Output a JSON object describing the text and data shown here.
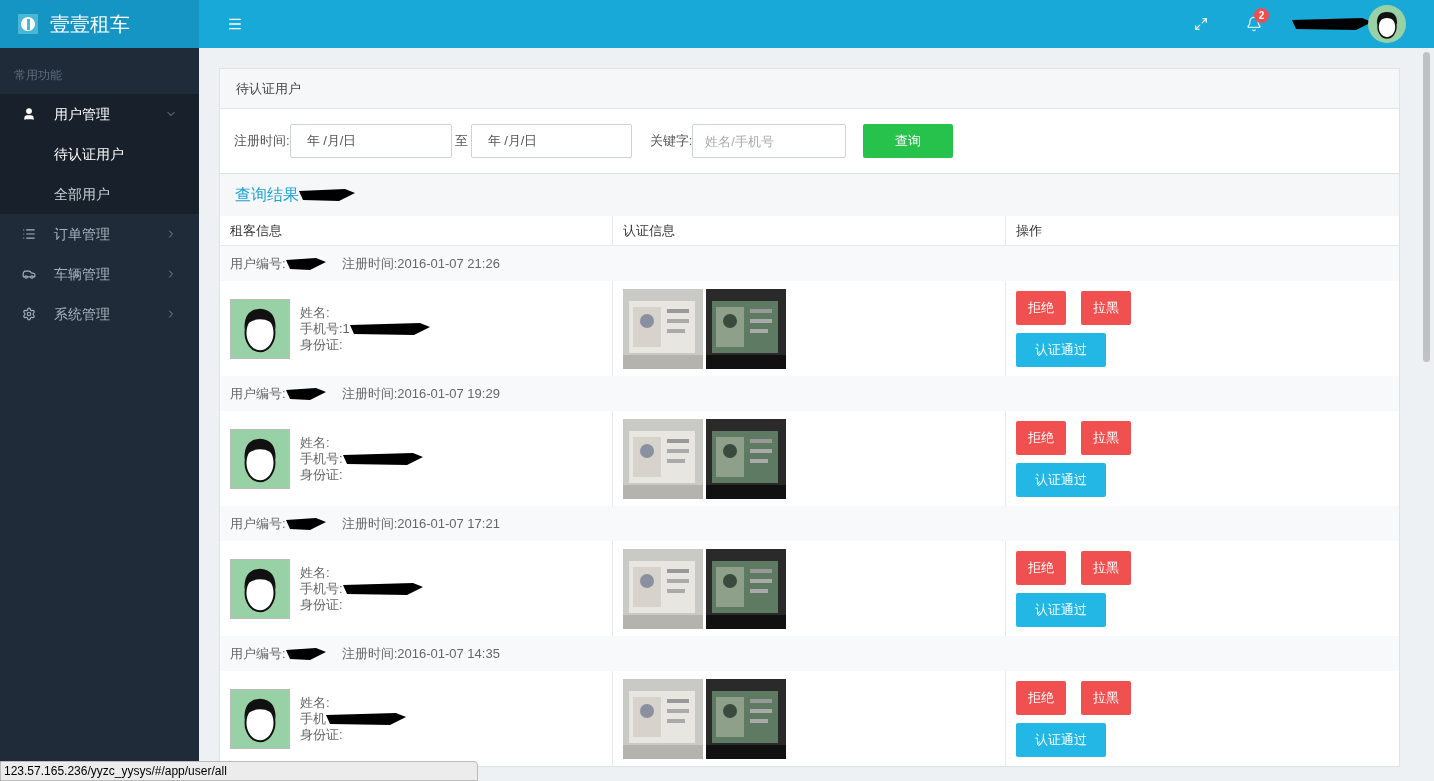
{
  "brand": {
    "name": "壹壹租车"
  },
  "header": {
    "notification_count": "2"
  },
  "sidebar": {
    "section": "常用功能",
    "items": [
      {
        "label": "用户管理",
        "kind": "user",
        "expanded": true,
        "selected": false,
        "children": [
          {
            "label": "待认证用户",
            "selected": true
          },
          {
            "label": "全部用户",
            "selected": false
          }
        ]
      },
      {
        "label": "订单管理",
        "kind": "list",
        "expanded": false,
        "selected": false
      },
      {
        "label": "车辆管理",
        "kind": "car",
        "expanded": false,
        "selected": false
      },
      {
        "label": "系统管理",
        "kind": "gear",
        "expanded": false,
        "selected": false
      }
    ]
  },
  "panel": {
    "title": "待认证用户",
    "filters": {
      "date_label": "注册时间:",
      "date_from": {
        "value": "年 /月/日"
      },
      "date_sep": "至",
      "date_to": {
        "value": "年 /月/日"
      },
      "keyword_label": "关键字:",
      "keyword": {
        "placeholder": "姓名/手机号"
      },
      "search_button": "查询"
    },
    "results_title": "查询结果",
    "columns": [
      "租客信息",
      "认证信息",
      "操作"
    ],
    "users": [
      {
        "id_label": "用户编号:",
        "registered": "注册时间:2016-01-07 21:26",
        "name_label": "姓名:",
        "phone_label": "手机号:1",
        "id_card_label": "身份证:",
        "photos": [
          {
            "kind": "picture"
          },
          {
            "kind": "picture"
          }
        ],
        "actions": [
          "拒绝",
          "拉黑",
          "认证通过"
        ]
      },
      {
        "id_label": "用户编号:",
        "registered": "注册时间:2016-01-07 19:29",
        "name_label": "姓名:",
        "phone_label": "手机号:",
        "id_card_label": "身份证:",
        "photos": [
          {
            "kind": "picture"
          },
          {
            "kind": "picture"
          }
        ],
        "actions": [
          "拒绝",
          "拉黑",
          "认证通过"
        ]
      },
      {
        "id_label": "用户编号:",
        "registered": "注册时间:2016-01-07 17:21",
        "name_label": "姓名:",
        "phone_label": "手机号:",
        "id_card_label": "身份证:",
        "photos": [
          {
            "kind": "picture"
          },
          {
            "kind": "picture"
          }
        ],
        "actions": [
          "拒绝",
          "拉黑",
          "认证通过"
        ]
      },
      {
        "id_label": "用户编号:",
        "registered": "注册时间:2016-01-07 14:35",
        "name_label": "姓名:",
        "phone_label": "手机",
        "id_card_label": "身份证:",
        "photos": [
          {
            "kind": "picture"
          },
          {
            "kind": "picture"
          }
        ],
        "actions": [
          "拒绝",
          "拉黑",
          "认证通过"
        ]
      }
    ]
  },
  "status_url": "123.57.165.236/yyzc_yysys/#/app/user/all"
}
